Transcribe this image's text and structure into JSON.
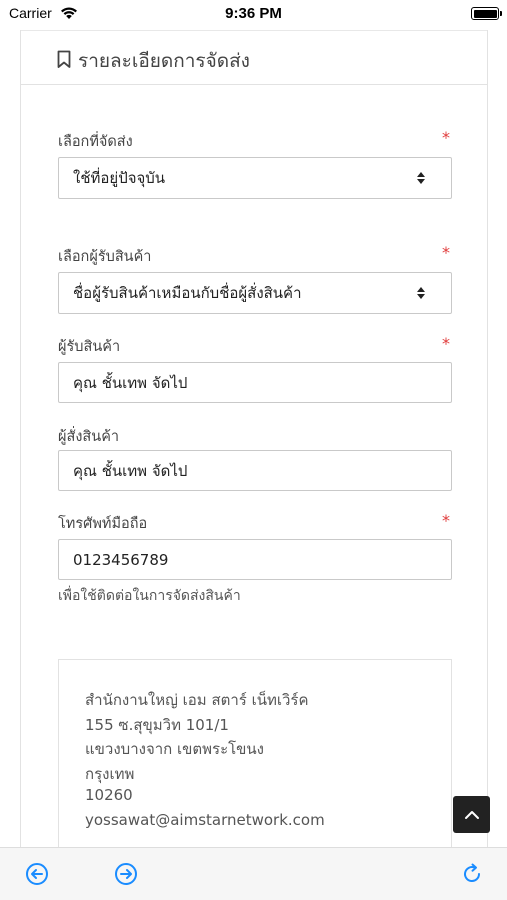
{
  "status_bar": {
    "carrier": "Carrier",
    "time": "9:36 PM"
  },
  "header": {
    "title": "รายละเอียดการจัดส่ง",
    "icon": "bookmark-icon"
  },
  "form": {
    "shipping_select": {
      "label": "เลือกที่จัดส่ง",
      "required": "*",
      "value": "ใช้ที่อยู่ปัจจุบัน"
    },
    "recipient_select": {
      "label": "เลือกผู้รับสินค้า",
      "required": "*",
      "value": "ชื่อผู้รับสินค้าเหมือนกับชื่อผู้สั่งสินค้า"
    },
    "recipient_name": {
      "label": "ผู้รับสินค้า",
      "required": "*",
      "value": "คุณ ชั้นเทพ จัดไป"
    },
    "orderer_name": {
      "label": "ผู้สั่งสินค้า",
      "value": "คุณ ชั้นเทพ จัดไป"
    },
    "phone": {
      "label": "โทรศัพท์มือถือ",
      "required": "*",
      "value": "0123456789",
      "help": "เพื่อใช้ติดต่อในการจัดส่งสินค้า"
    }
  },
  "address": {
    "lines": [
      "สำนักงานใหญ่ เอม สตาร์ เน็ทเวิร์ค",
      "155 ซ.สุขุมวิท 101/1",
      "แขวงบางจาก เขตพระโขนง",
      "กรุงเทพ",
      "10260",
      "yossawat@aimstarnetwork.com"
    ]
  },
  "colors": {
    "accent_blue": "#1a8cff",
    "required_red": "#e03b3b",
    "border": "#c9c9c9"
  },
  "icons": {
    "scroll_top": "chevron-up-icon",
    "back": "arrow-left-circle-icon",
    "forward": "arrow-right-circle-icon",
    "reload": "reload-icon"
  }
}
